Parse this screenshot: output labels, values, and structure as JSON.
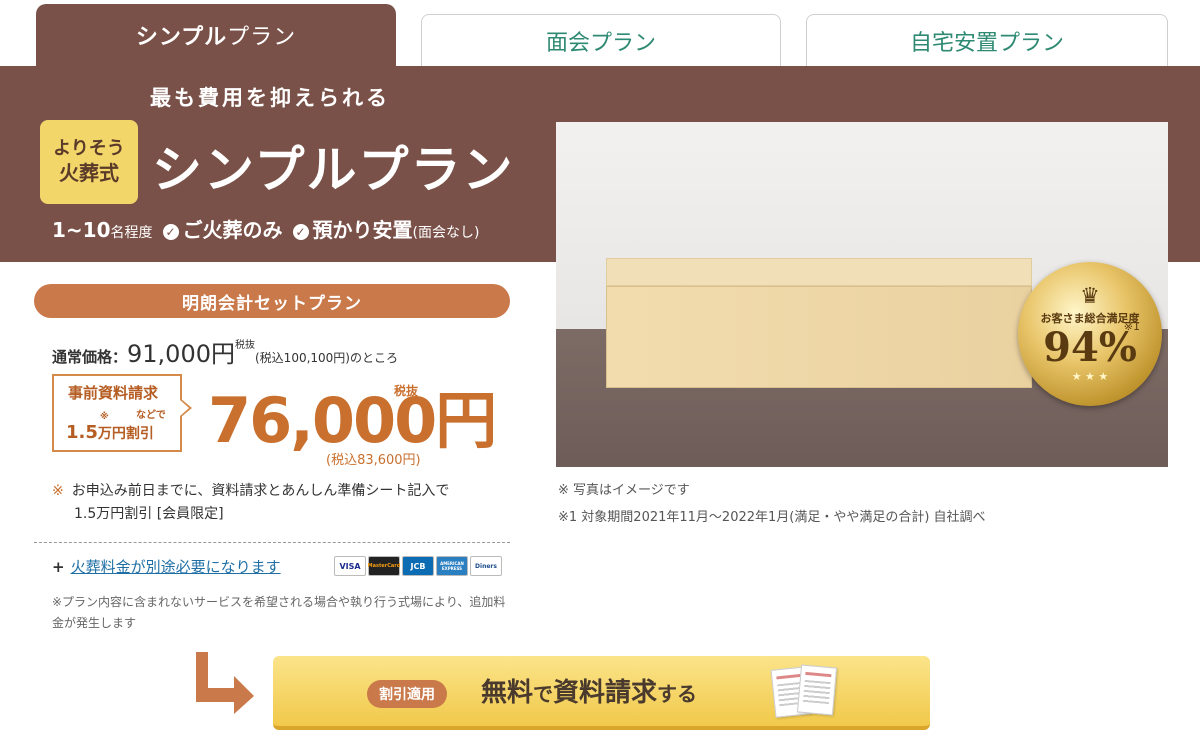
{
  "tabs": [
    {
      "label_bold": "シンプル",
      "label_light": "プラン"
    },
    {
      "label": "面会プラン"
    },
    {
      "label": "自宅安置プラン"
    }
  ],
  "hero": {
    "subtitle": "最も費用を抑えられる",
    "logo_line1": "よりそう",
    "logo_line2": "火葬式",
    "title": "シンプルプラン",
    "capacity_num": "1~10",
    "capacity_suffix": "名程度",
    "features": [
      "ご火葬のみ",
      "預かり安置"
    ],
    "feature_note": "(面会なし)"
  },
  "photo": {
    "seal_caption": "お客さま総合満足度",
    "seal_value": "94%",
    "seal_note": "※1",
    "note1": "※ 写真はイメージです",
    "note2": "※1 対象期間2021年11月〜2022年1月(満足・やや満足の合計) 自社調べ"
  },
  "pricing": {
    "plan_pill": "明朗会計セットプラン",
    "regular_label": "通常価格：",
    "regular_amount": "91,000円",
    "regular_tax": "税抜",
    "regular_rest": "(税込100,100円)のところ",
    "discount_line1": "事前資料請求",
    "discount_line2": "などで",
    "discount_mark": "※",
    "discount_amount": "1.5",
    "discount_unit": "万円割引",
    "price": "76,000円",
    "price_tax": "税抜",
    "price_incl": "(税込83,600円)",
    "note_mark": "※",
    "note_line1": "お申込み前日までに、資料請求とあんしん準備シート記入で",
    "note_line2": "1.5万円割引 [会員限定]",
    "extra_plus": "+",
    "extra_link": "火葬料金が別途必要になります",
    "service_note": "※プラン内容に含まれないサービスを希望される場合や執り行う式場により、追加料金が発生します"
  },
  "cards": [
    "VISA",
    "MasterCard",
    "JCB",
    "AMERICAN EXPRESS",
    "Diners"
  ],
  "cta": {
    "badge": "割引適用",
    "text1": "無料",
    "text2": "で",
    "text3": "資料請求",
    "text4": "する"
  },
  "colors": {
    "brand_brown": "#7a5148",
    "accent_orange": "#c9794a",
    "price_orange": "#c9702e",
    "tab_green": "#2e8a72",
    "cta_yellow": "#f1c94b"
  }
}
